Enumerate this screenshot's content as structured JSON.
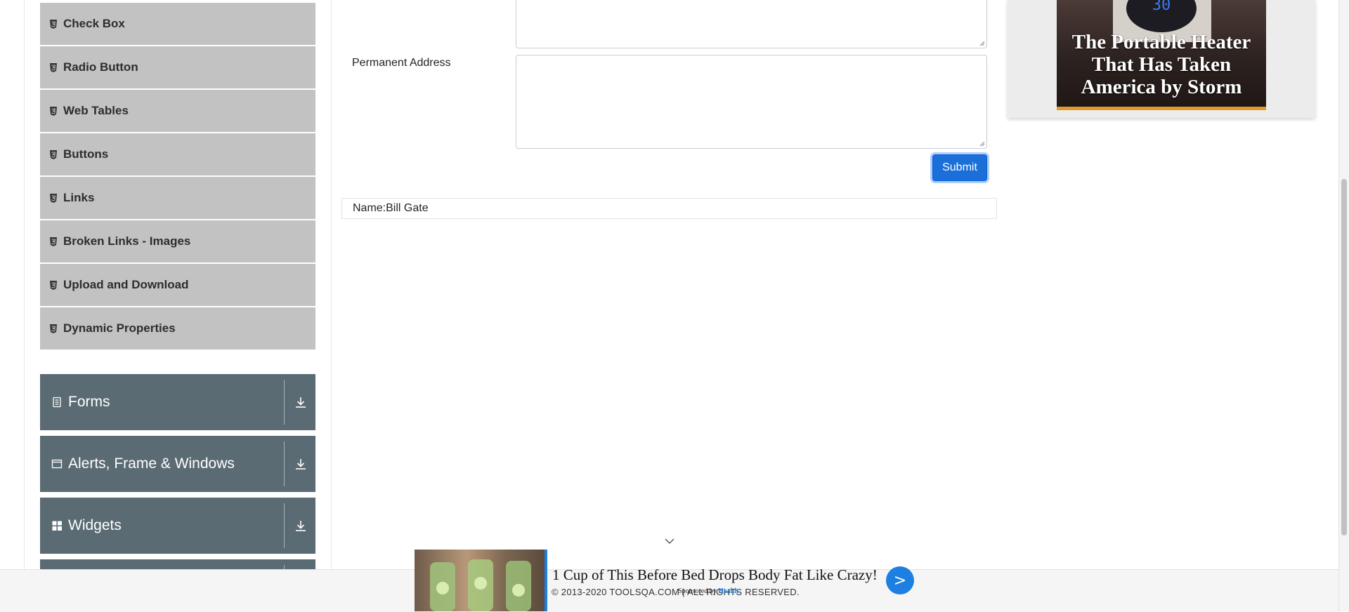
{
  "sidebar": {
    "element_items": [
      {
        "label": "Check Box",
        "icon": "html5-icon"
      },
      {
        "label": "Radio Button",
        "icon": "html5-icon"
      },
      {
        "label": "Web Tables",
        "icon": "html5-icon"
      },
      {
        "label": "Buttons",
        "icon": "html5-icon"
      },
      {
        "label": "Links",
        "icon": "html5-icon"
      },
      {
        "label": "Broken Links - Images",
        "icon": "html5-icon"
      },
      {
        "label": "Upload and Download",
        "icon": "html5-icon"
      },
      {
        "label": "Dynamic Properties",
        "icon": "html5-icon"
      }
    ],
    "groups": [
      {
        "label": "Forms",
        "icon": "document-icon"
      },
      {
        "label": "Alerts, Frame & Windows",
        "icon": "window-icon"
      },
      {
        "label": "Widgets",
        "icon": "grid-icon"
      }
    ]
  },
  "form": {
    "permanent_address_label": "Permanent Address",
    "submit_label": "Submit"
  },
  "output": {
    "name_text": "Name:Bill Gate"
  },
  "ads": {
    "right_headline": "The Portable Heater That Has Taken America by Storm",
    "right_display_value": "30",
    "bottom_headline": "1 Cup of This Before Bed Drops Body Fat Like Crazy!",
    "bottom_sponsor_prefix": "Sponsored by",
    "bottom_sponsor_brand": "Health",
    "bottom_go_label": ">"
  },
  "footer": {
    "copyright": "© 2013-2020 TOOLSQA.COM | ALL RIGHTS RESERVED."
  },
  "colors": {
    "menu_item_bg": "#c2c2c2",
    "group_bg": "#5b6b73",
    "submit_bg": "#1a6fd8"
  }
}
